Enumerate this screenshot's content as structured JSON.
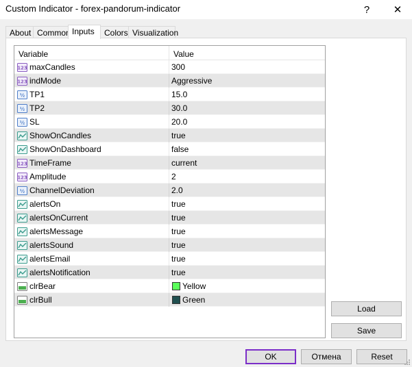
{
  "window": {
    "title": "Custom Indicator - forex-pandorum-indicator",
    "help_glyph": "?",
    "close_glyph": "✕"
  },
  "tabs": [
    {
      "label": "About"
    },
    {
      "label": "Common"
    },
    {
      "label": "Inputs"
    },
    {
      "label": "Colors"
    },
    {
      "label": "Visualization"
    }
  ],
  "active_tab": "Inputs",
  "grid": {
    "headers": {
      "variable": "Variable",
      "value": "Value"
    },
    "rows": [
      {
        "name": "maxCandles",
        "value": "300",
        "icon": "int-icon"
      },
      {
        "name": "indMode",
        "value": "Aggressive",
        "icon": "int-icon"
      },
      {
        "name": "TP1",
        "value": "15.0",
        "icon": "double-icon"
      },
      {
        "name": "TP2",
        "value": "30.0",
        "icon": "double-icon"
      },
      {
        "name": "SL",
        "value": "20.0",
        "icon": "double-icon"
      },
      {
        "name": "ShowOnCandles",
        "value": "true",
        "icon": "bool-icon"
      },
      {
        "name": "ShowOnDashboard",
        "value": "false",
        "icon": "bool-icon"
      },
      {
        "name": "TimeFrame",
        "value": "current",
        "icon": "int-icon"
      },
      {
        "name": "Amplitude",
        "value": "2",
        "icon": "int-icon"
      },
      {
        "name": "ChannelDeviation",
        "value": "2.0",
        "icon": "double-icon"
      },
      {
        "name": "alertsOn",
        "value": "true",
        "icon": "bool-icon"
      },
      {
        "name": "alertsOnCurrent",
        "value": "true",
        "icon": "bool-icon"
      },
      {
        "name": "alertsMessage",
        "value": "true",
        "icon": "bool-icon"
      },
      {
        "name": "alertsSound",
        "value": "true",
        "icon": "bool-icon"
      },
      {
        "name": "alertsEmail",
        "value": "true",
        "icon": "bool-icon"
      },
      {
        "name": "alertsNotification",
        "value": "true",
        "icon": "bool-icon"
      },
      {
        "name": "clrBear",
        "value": "Yellow",
        "icon": "color-icon",
        "swatch": "#5bff5b"
      },
      {
        "name": "clrBull",
        "value": "Green",
        "icon": "color-icon",
        "swatch": "#1f4f4f"
      }
    ]
  },
  "buttons": {
    "load": "Load",
    "save": "Save",
    "ok": "OK",
    "cancel": "Отмена",
    "reset": "Reset"
  },
  "colors": {
    "accent_ok_border": "#7b2ec8",
    "row_alt": "#e6e6e6",
    "icon_int": "#8a5cc0",
    "icon_double": "#4d7dc8",
    "icon_bool": "#3a9a8c",
    "icon_color": "#4caf50"
  }
}
